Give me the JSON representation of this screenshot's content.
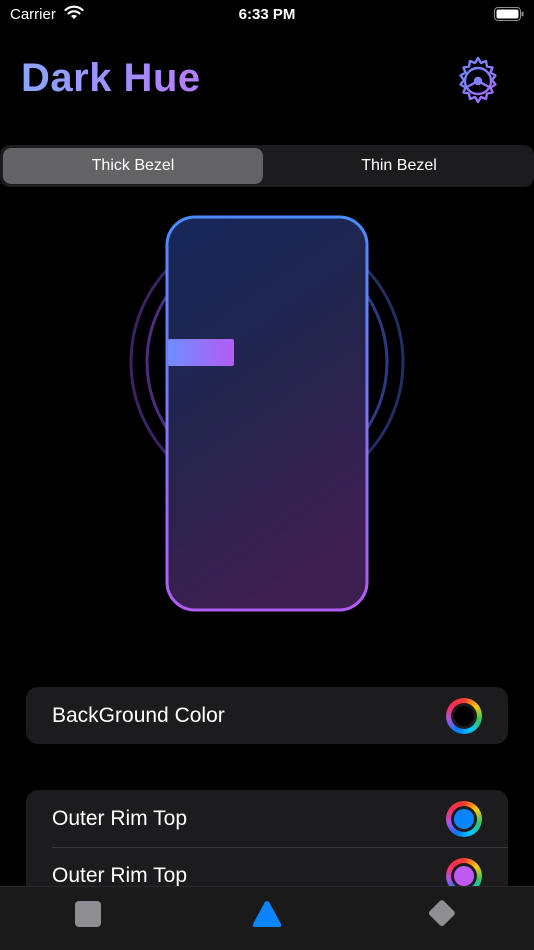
{
  "status_bar": {
    "carrier": "Carrier",
    "time": "6:33 PM"
  },
  "header": {
    "title": "Dark Hue",
    "settings_icon": "gear-icon"
  },
  "segmented_control": {
    "options": [
      "Thick Bezel",
      "Thin Bezel"
    ],
    "selected": "Thick Bezel"
  },
  "settings": {
    "background": {
      "label": "BackGround Color",
      "color": "#000000"
    },
    "outer_rim": [
      {
        "label": "Outer Rim Top",
        "color": "#0a84ff"
      },
      {
        "label": "Outer Rim Top",
        "color": "#bf5af2"
      }
    ]
  },
  "tab_bar": {
    "tabs": [
      {
        "icon": "square-icon",
        "selected": false
      },
      {
        "icon": "triangle-icon",
        "selected": true
      },
      {
        "icon": "diamond-icon",
        "selected": false
      }
    ]
  },
  "colors": {
    "accent_blue": "#0a84ff",
    "accent_purple": "#bf5af2",
    "title_gradient_start": "#8aa6ff",
    "title_gradient_end": "#b47cff"
  }
}
